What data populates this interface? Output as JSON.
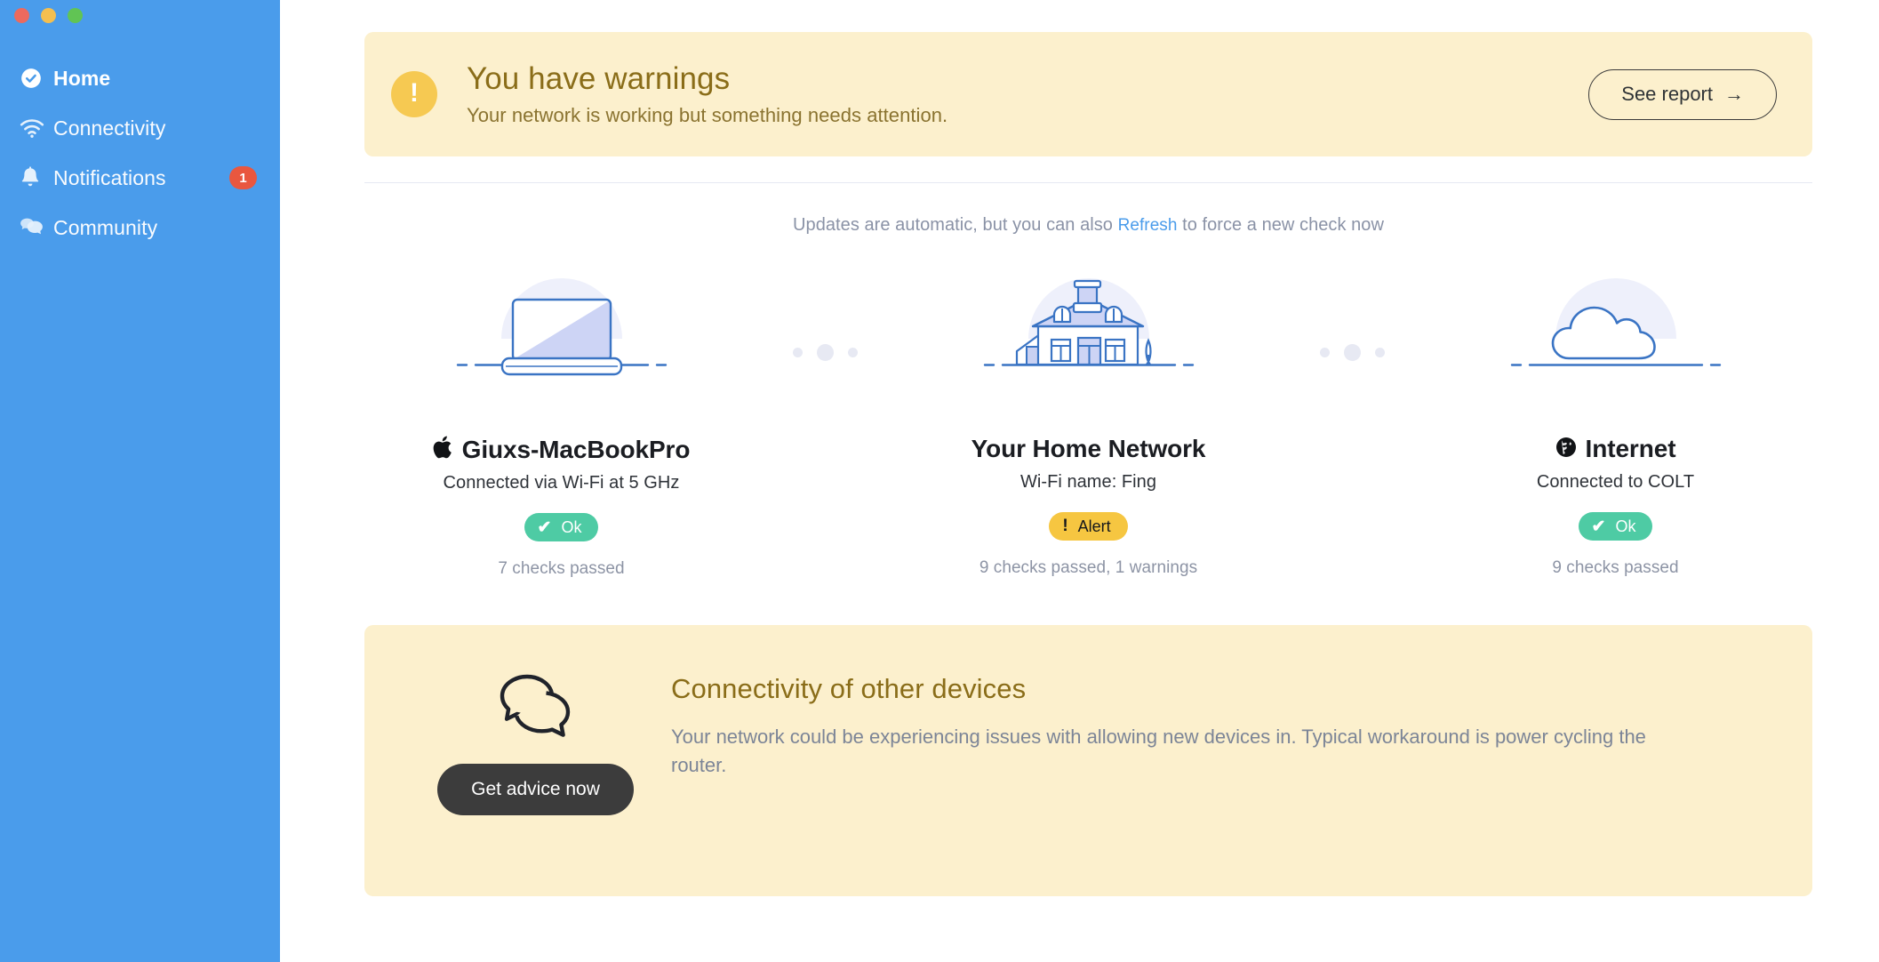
{
  "window": {
    "traffic_lights": [
      {
        "name": "close",
        "color": "#ec6a5e"
      },
      {
        "name": "minimize",
        "color": "#f4bf4f"
      },
      {
        "name": "zoom",
        "color": "#61c454"
      }
    ]
  },
  "sidebar": {
    "accent": "#4a9ceb",
    "items": [
      {
        "label": "Home",
        "icon": "check-circle-icon",
        "active": true,
        "badge": null
      },
      {
        "label": "Connectivity",
        "icon": "wifi-icon",
        "active": false,
        "badge": null
      },
      {
        "label": "Notifications",
        "icon": "bell-icon",
        "active": false,
        "badge": "1"
      },
      {
        "label": "Community",
        "icon": "chat-bubbles-icon",
        "active": false,
        "badge": null
      }
    ]
  },
  "banner": {
    "icon": "exclamation-circle-icon",
    "glyph": "!",
    "title": "You have warnings",
    "subtitle": "Your network is working but something needs attention.",
    "cta_label": "See report",
    "cta_arrow": "→",
    "bg": "#fcf0cd",
    "icon_color": "#f6c952",
    "title_color": "#8a6d19"
  },
  "refresh": {
    "before": "Updates are automatic, but you can also",
    "link": "Refresh",
    "after": "to force a new check now",
    "link_color": "#4a9ceb"
  },
  "status": {
    "cards": [
      {
        "illustration": "laptop-illustration",
        "title": "Giuxs-MacBookPro",
        "title_glyph": "",
        "title_glyph_name": "apple-logo-icon",
        "subtitle": "Connected via Wi-Fi at 5 GHz",
        "badge": {
          "label": "Ok",
          "glyph": "✔",
          "glyph_name": "check-icon",
          "kind": "ok",
          "color": "#4ecba4"
        },
        "checks": "7 checks passed"
      },
      {
        "illustration": "house-illustration",
        "title": "Your Home Network",
        "title_glyph": "",
        "title_glyph_name": "",
        "subtitle": "Wi-Fi name: Fing",
        "badge": {
          "label": "Alert",
          "glyph": "!",
          "glyph_name": "exclamation-icon",
          "kind": "alert",
          "color": "#f6c641"
        },
        "checks": "9 checks passed, 1 warnings"
      },
      {
        "illustration": "cloud-illustration",
        "title": "Internet",
        "title_glyph": "🌐",
        "title_glyph_name": "globe-icon",
        "subtitle": "Connected to COLT",
        "badge": {
          "label": "Ok",
          "glyph": "✔",
          "glyph_name": "check-icon",
          "kind": "ok",
          "color": "#4ecba4"
        },
        "checks": "9 checks passed"
      }
    ]
  },
  "advice": {
    "icon": "chat-bubbles-outline-icon",
    "button_label": "Get advice now",
    "title": "Connectivity of other devices",
    "body": "Your network could be experiencing issues with allowing new devices in. Typical workaround is power cycling the router.",
    "bg": "#fcf0cd",
    "title_color": "#8a6d19"
  }
}
